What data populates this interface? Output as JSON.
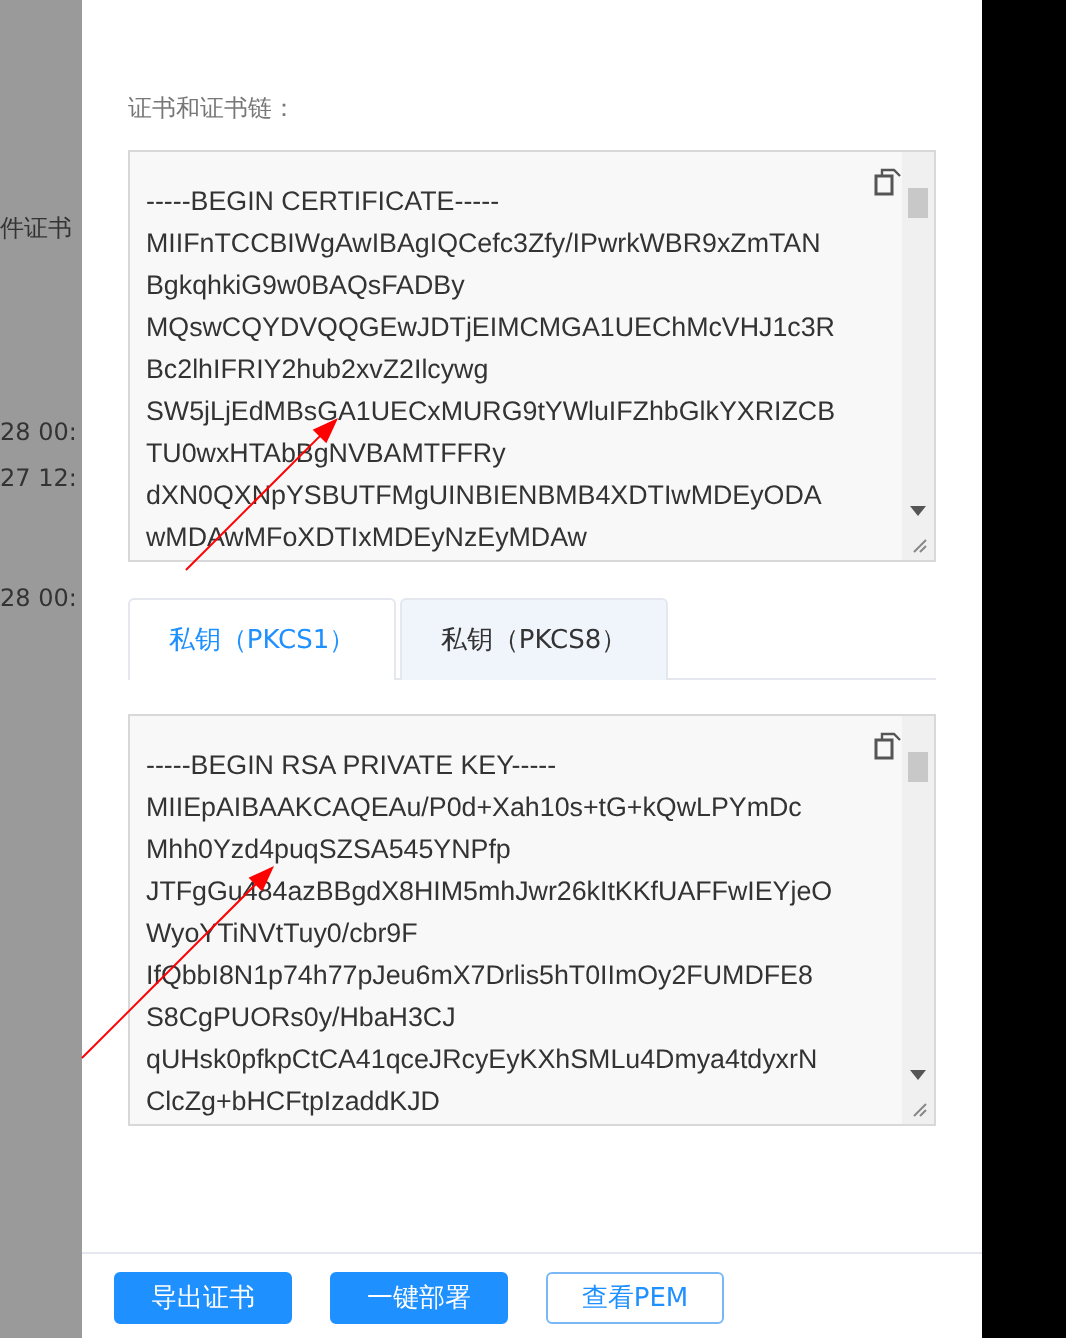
{
  "background": {
    "texts": [
      "件证书",
      "28 00:",
      "27 12:",
      "28 00:"
    ]
  },
  "drawer": {
    "certificate_label": "证书和证书链：",
    "certificate_lines": [
      "-----BEGIN CERTIFICATE-----",
      "MIIFnTCCBIWgAwIBAgIQCefc3Zfy/IPwrkWBR9xZmTAN",
      "BgkqhkiG9w0BAQsFADBy",
      "MQswCQYDVQQGEwJDTjEIMCMGA1UEChMcVHJ1c3R",
      "Bc2lhIFRIY2hub2xvZ2Ilcywg",
      "SW5jLjEdMBsGA1UECxMURG9tYWluIFZhbGlkYXRIZCB",
      "TU0wxHTAbBgNVBAMTFFRy",
      "dXN0QXNpYSBUTFMgUINBIENBMB4XDTIwMDEyODA",
      "wMDAwMFoXDTIxMDEyNzEyMDAw"
    ],
    "tabs": [
      {
        "label": "私钥（PKCS1）",
        "selected": true
      },
      {
        "label": "私钥（PKCS8）",
        "selected": false
      }
    ],
    "key_lines": [
      "-----BEGIN RSA PRIVATE KEY-----",
      "MIIEpAIBAAKCAQEAu/P0d+Xah10s+tG+kQwLPYmDc",
      "Mhh0Yzd4puqSZSA545YNPfp",
      "JTFgGu484azBBgdX8HIM5mhJwr26kItKKfUAFFwIEYjeO",
      "WyoYTiNVtTuy0/cbr9F",
      "IfQbbI8N1p74h77pJeu6mX7Drlis5hT0IImOy2FUMDFE8",
      "S8CgPUORs0y/HbaH3CJ",
      "qUHsk0pfkpCtCA41qceJRcyEyKXhSMLu4Dmya4tdyxrN",
      "ClcZg+bHCFtpIzaddKJD"
    ],
    "buttons": [
      {
        "label": "导出证书",
        "kind": "primary"
      },
      {
        "label": "一键部署",
        "kind": "primary"
      },
      {
        "label": "查看PEM",
        "kind": "outline"
      }
    ]
  }
}
